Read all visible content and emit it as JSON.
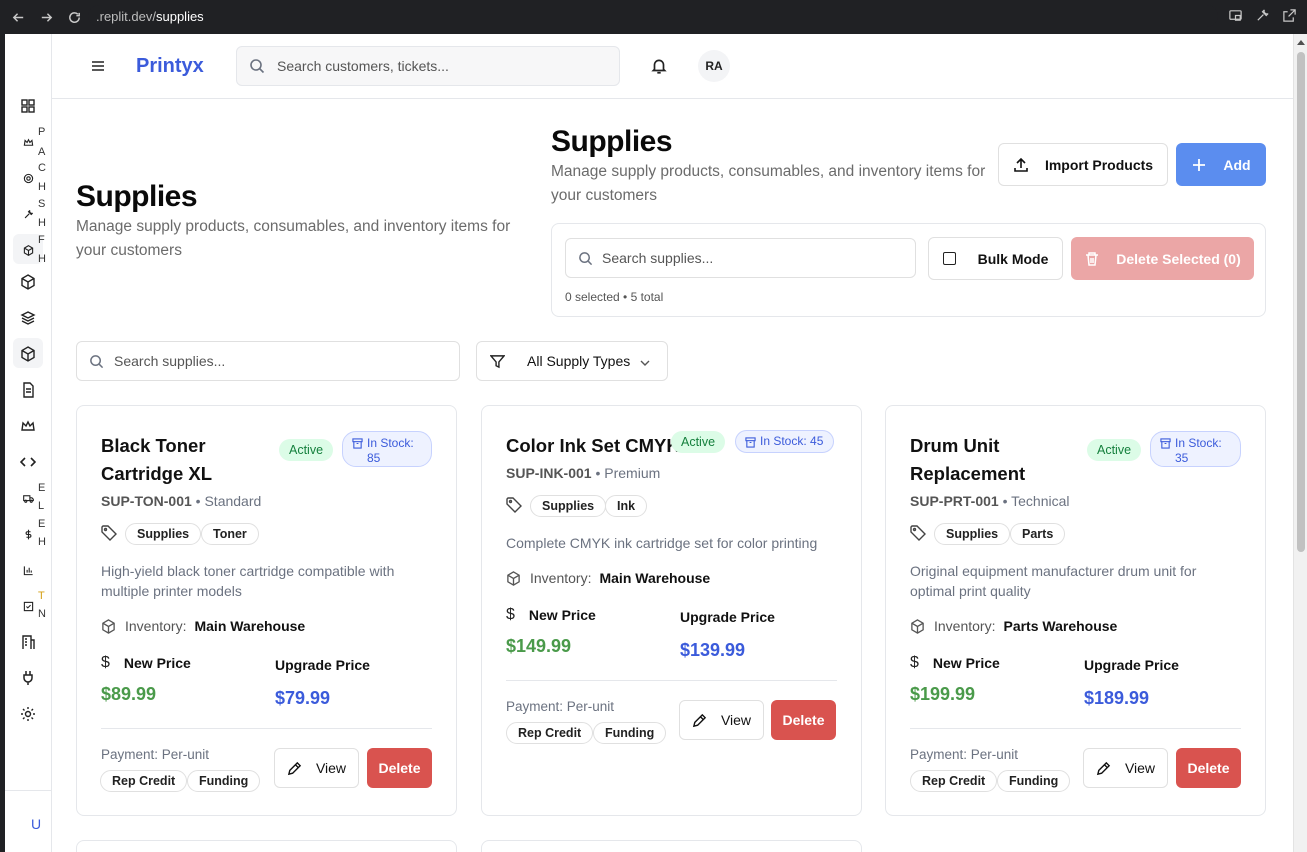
{
  "browser": {
    "url_host": ".replit.dev/",
    "url_path": "supplies"
  },
  "sidebar": {
    "letters": [
      "P",
      "A",
      "C",
      "H",
      "S",
      "H",
      "F",
      "H",
      "E",
      "L",
      "E",
      "H",
      "T",
      "N"
    ],
    "footer_label": "U"
  },
  "topbar": {
    "brand": "Printyx",
    "search_placeholder": "Search customers, tickets...",
    "avatar_initials": "RA"
  },
  "header_left": {
    "title": "Supplies",
    "subtitle": "Manage supply products, consumables, and inventory items for your customers"
  },
  "header_right": {
    "title": "Supplies",
    "subtitle": "Manage supply products, consumables, and inventory items for your customers",
    "import_label": "Import Products",
    "add_label": "Add"
  },
  "toolbar": {
    "search_placeholder": "Search supplies...",
    "bulk_label": "Bulk Mode",
    "delete_selected_label": "Delete Selected (0)",
    "count_text": "0 selected • 5 total"
  },
  "filters": {
    "search_placeholder": "Search supplies...",
    "type_selected": "All Supply Types"
  },
  "labels": {
    "inventory": "Inventory:",
    "new_price": "New Price",
    "upgrade_price": "Upgrade Price",
    "view": "View",
    "delete": "Delete"
  },
  "cards": [
    {
      "title": "Black Toner Cartridge XL",
      "status": "Active",
      "stock_line1": "In Stock:",
      "stock_line2": "85",
      "sku": "SUP-TON-001",
      "tier": "• Standard",
      "tags": [
        "Supplies",
        "Toner"
      ],
      "description": "High-yield black toner cartridge compatible with multiple printer models",
      "warehouse": "Main Warehouse",
      "new_price": "$89.99",
      "upgrade_price": "$79.99",
      "payment": "Payment: Per-unit",
      "payment_tags": [
        "Rep Credit",
        "Funding"
      ]
    },
    {
      "title": "Color Ink Set CMYK",
      "status": "Active",
      "stock_line1": "In Stock: 45",
      "stock_line2": "",
      "sku": "SUP-INK-001",
      "tier": "• Premium",
      "tags": [
        "Supplies",
        "Ink"
      ],
      "description": "Complete CMYK ink cartridge set for color printing",
      "warehouse": "Main Warehouse",
      "new_price": "$149.99",
      "upgrade_price": "$139.99",
      "payment": "Payment: Per-unit",
      "payment_tags": [
        "Rep Credit",
        "Funding"
      ]
    },
    {
      "title": "Drum Unit Replacement",
      "status": "Active",
      "stock_line1": "In Stock:",
      "stock_line2": "35",
      "sku": "SUP-PRT-001",
      "tier": "• Technical",
      "tags": [
        "Supplies",
        "Parts"
      ],
      "description": "Original equipment manufacturer drum unit for optimal print quality",
      "warehouse": "Parts Warehouse",
      "new_price": "$199.99",
      "upgrade_price": "$189.99",
      "payment": "Payment: Per-unit",
      "payment_tags": [
        "Rep Credit",
        "Funding"
      ]
    }
  ]
}
